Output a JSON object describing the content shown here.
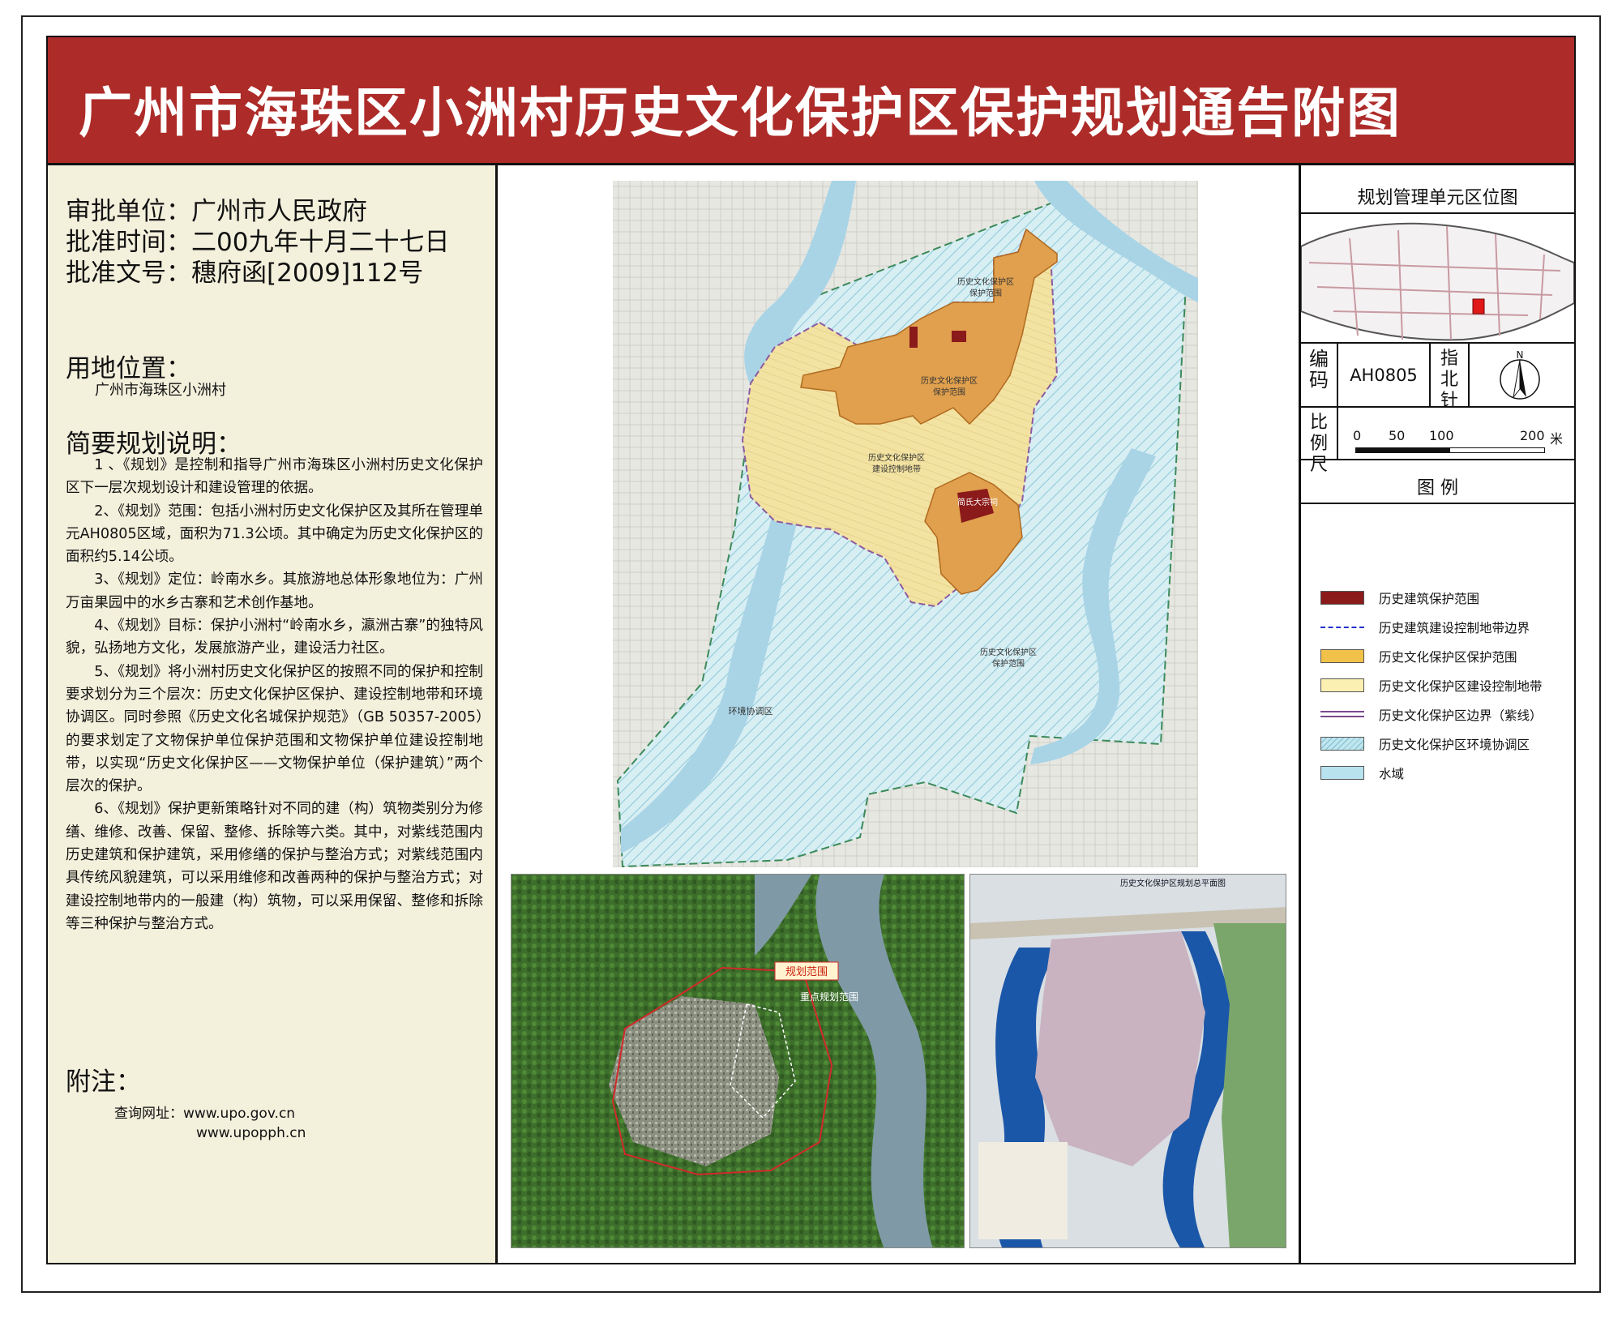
{
  "title": "广州市海珠区小洲村历史文化保护区保护规划通告附图",
  "approval": {
    "unit": "审批单位：广州市人民政府",
    "date": "批准时间：二00九年十月二十七日",
    "doc_no": "批准文号：穗府函[2009]112号"
  },
  "site": {
    "heading": "用地位置：",
    "value": "广州市海珠区小洲村"
  },
  "description": {
    "heading": "简要规划说明：",
    "paragraphs": [
      "1 、《规划》是控制和指导广州市海珠区小洲村历史文化保护区下一层次规划设计和建设管理的依据。",
      "2、《规划》范围：包括小洲村历史文化保护区及其所在管理单元AH0805区域，面积为71.3公顷。其中确定为历史文化保护区的面积约5.14公顷。",
      "3、《规划》定位：岭南水乡。其旅游地总体形象地位为：广州万亩果园中的水乡古寨和艺术创作基地。",
      "4、《规划》目标：保护小洲村“岭南水乡，瀛洲古寨”的独特风貌，弘扬地方文化，发展旅游产业，建设活力社区。",
      "5、《规划》将小洲村历史文化保护区的按照不同的保护和控制要求划分为三个层次：历史文化保护区保护、建设控制地带和环境协调区。同时参照《历史文化名城保护规范》（GB 50357-2005）的要求划定了文物保护单位保护范围和文物保护单位建设控制地带，以实现“历史文化保护区——文物保护单位（保护建筑）”两个层次的保护。",
      "6、《规划》保护更新策略针对不同的建（构）筑物类别分为修缮、维修、改善、保留、整修、拆除等六类。其中，对紫线范围内历史建筑和保护建筑，采用修缮的保护与整治方式；对紫线范围内具传统风貌建筑，可以采用维修和改善两种的保护与整治方式；对建设控制地带内的一般建（构）筑物，可以采用保留、整修和拆除等三种保护与整治方式。"
    ]
  },
  "notes": {
    "heading": "附注：",
    "query_label": "查询网址：www.upo.gov.cn",
    "url2": "www.upopph.cn"
  },
  "map_labels": {
    "zone_a": "历史文化保护区",
    "zone_a2": "保护范围",
    "core_top": "历史文化保护区",
    "core_top2": "保护范围",
    "control": "历史文化保护区",
    "control2": "建设控制地带",
    "core_bottom": "历史文化保护区",
    "core_bottom2": "保护范围",
    "env": "环境协调区",
    "hall": "简氏大宗祠"
  },
  "aerial": {
    "label_plan": "规划范围",
    "label_key": "重点规划范围"
  },
  "masterplan": {
    "caption": "历史文化保护区规划总平面图"
  },
  "right": {
    "location_title": "规划管理单元区位图",
    "code_label": "编码",
    "code_value": "AH0805",
    "north_label": "指北针",
    "north_letter": "N",
    "scale_label": "比例尺",
    "scale_ticks": [
      "0",
      "50",
      "100",
      "200"
    ],
    "scale_unit": "米",
    "legend_title": "图  例"
  },
  "legend": [
    {
      "label": "历史建筑保护范围",
      "color": "#8b1a1a",
      "style": "fill"
    },
    {
      "label": "历史建筑建设控制地带边界",
      "color": "#2233cc",
      "style": "dashline"
    },
    {
      "label": "历史文化保护区保护范围",
      "color": "#f2c14a",
      "style": "fill"
    },
    {
      "label": "历史文化保护区建设控制地带",
      "color": "#fbefb1",
      "style": "fill"
    },
    {
      "label": "历史文化保护区边界（紫线）",
      "color": "#7a4a8c",
      "style": "doubleline"
    },
    {
      "label": "历史文化保护区环境协调区",
      "color": "#bfe6ee",
      "style": "hatch"
    },
    {
      "label": "水域",
      "color": "#b8e2ee",
      "style": "fill"
    }
  ],
  "colors": {
    "title_bg": "#ad2b28",
    "panel_bg": "#f3f0dc",
    "water": "#a9d4e6",
    "core": "#e0a04e",
    "control": "#f3e3a2",
    "heritage": "#8b1a1a"
  }
}
